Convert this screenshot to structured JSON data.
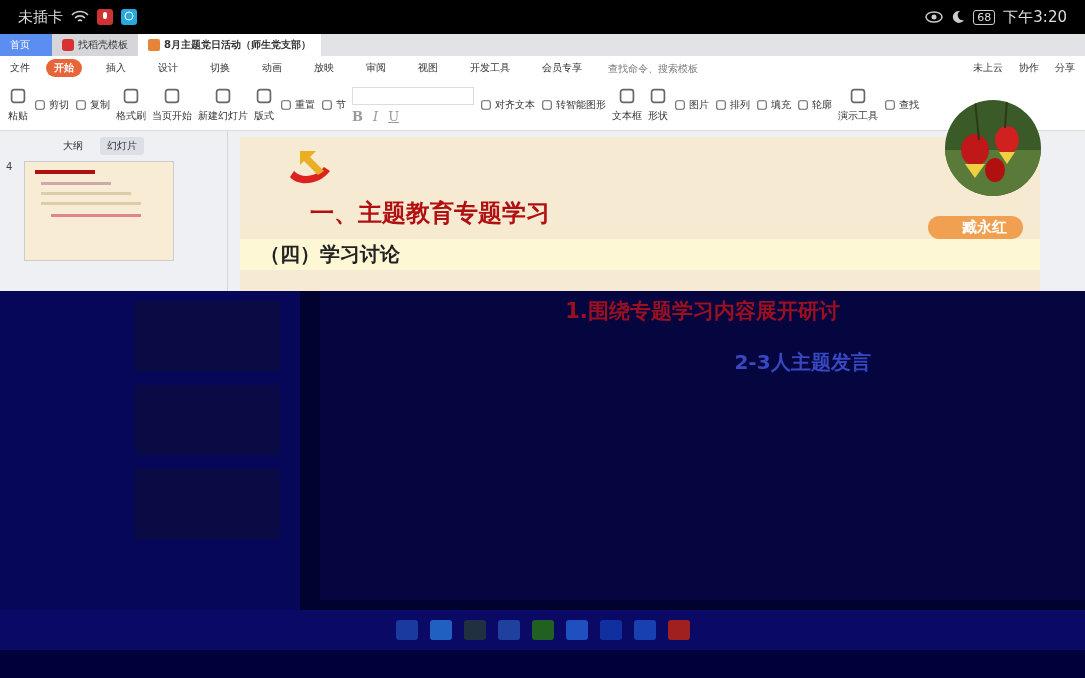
{
  "status_bar": {
    "carrier": "未插卡",
    "battery": "68",
    "time": "下午3:20"
  },
  "tabs": [
    {
      "label": "首页",
      "kind": "home",
      "selected": false
    },
    {
      "label": "找稻壳模板",
      "kind": "template",
      "selected": false
    },
    {
      "label": "8月主题党日活动（师生党支部）",
      "kind": "document",
      "selected": true
    }
  ],
  "menu": {
    "file": "文件",
    "items": [
      {
        "label": "开始",
        "selected": true
      },
      {
        "label": "插入",
        "selected": false
      },
      {
        "label": "设计",
        "selected": false
      },
      {
        "label": "切换",
        "selected": false
      },
      {
        "label": "动画",
        "selected": false
      },
      {
        "label": "放映",
        "selected": false
      },
      {
        "label": "审阅",
        "selected": false
      },
      {
        "label": "视图",
        "selected": false
      },
      {
        "label": "开发工具",
        "selected": false
      },
      {
        "label": "会员专享",
        "selected": false
      }
    ],
    "search_placeholder": "查找命令、搜索模板",
    "actions": [
      "未上云",
      "协作",
      "分享"
    ]
  },
  "ribbon": {
    "left": [
      {
        "label": "粘贴",
        "kind": "big"
      },
      {
        "label": "剪切",
        "kind": "small"
      },
      {
        "label": "复制",
        "kind": "small"
      },
      {
        "label": "格式刷",
        "kind": "big"
      },
      {
        "label": "当页开始",
        "kind": "big"
      },
      {
        "label": "新建幻灯片",
        "kind": "big"
      },
      {
        "label": "版式",
        "kind": "big"
      },
      {
        "label": "重置",
        "kind": "small"
      },
      {
        "label": "节",
        "kind": "small"
      }
    ],
    "format": [
      "B",
      "I",
      "U"
    ],
    "right": [
      {
        "label": "对齐文本",
        "kind": "small"
      },
      {
        "label": "转智能图形",
        "kind": "small"
      },
      {
        "label": "文本框",
        "kind": "big"
      },
      {
        "label": "形状",
        "kind": "big"
      },
      {
        "label": "图片",
        "kind": "small"
      },
      {
        "label": "排列",
        "kind": "small"
      },
      {
        "label": "填充",
        "kind": "small"
      },
      {
        "label": "轮廓",
        "kind": "small"
      },
      {
        "label": "演示工具",
        "kind": "big"
      },
      {
        "label": "查找",
        "kind": "small"
      }
    ]
  },
  "panel": {
    "tabs": [
      {
        "label": "大纲",
        "selected": false
      },
      {
        "label": "幻灯片",
        "selected": true
      }
    ],
    "slide_number": "4"
  },
  "slide": {
    "title": "一、主题教育专题学习",
    "subtitle": "（四）学习讨论",
    "points": [
      "1.围绕专题学习内容展开研讨",
      "2-3人主题发言"
    ]
  },
  "video": {
    "name": "臧永红"
  }
}
